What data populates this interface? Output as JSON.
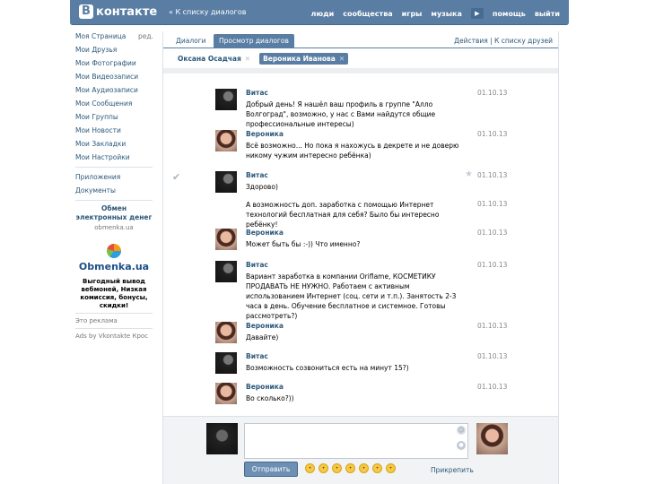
{
  "header": {
    "logo_letter": "B",
    "logo_text": "контакте",
    "back_link": "« К списку диалогов",
    "nav": [
      "люди",
      "сообщества",
      "игры",
      "музыка"
    ],
    "play_icon": "play-icon",
    "nav_right": [
      "помощь",
      "выйти"
    ]
  },
  "sidebar": {
    "items": [
      "Моя Страница",
      "Мои Друзья",
      "Мои Фотографии",
      "Мои Видеозаписи",
      "Мои Аудиозаписи",
      "Мои Сообщения",
      "Мои Группы",
      "Мои Новости",
      "Мои Закладки",
      "Мои Настройки"
    ],
    "edit_label": "ред.",
    "extra_items": [
      "Приложения",
      "Документы"
    ],
    "ad": {
      "title": "Обмен электронных денег",
      "url": "obmenka.ua",
      "logo_text": "Obmenka.ua",
      "description": "Выгодный вывод вебмоней, Низкая комиссия, бонусы, скидки!",
      "small1": "Это реклама",
      "small2": "Ads by Vkontakte Крос"
    }
  },
  "tabs": {
    "items": [
      "Диалоги",
      "Просмотр диалогов"
    ],
    "right": "Действия | К списку друзей"
  },
  "participants": [
    {
      "name": "Оксана Осадчая"
    },
    {
      "name": "Вероника Иванова"
    }
  ],
  "messages": [
    {
      "name": "Витас",
      "avatar": "vitas",
      "text": "Добрый день! Я нашёл ваш профиль в группе \"Алло Волгоград\", возможно, у нас с Вами найдутся общие профессиональные интересы)",
      "time": "01.10.13"
    },
    {
      "name": "Вероника",
      "avatar": "veronika",
      "text": "Всё возможно... Но пока я нахожусь в декрете и не доверю никому чужим интересно ребёнка)",
      "time": "01.10.13"
    },
    {
      "name": "Витас",
      "avatar": "vitas",
      "text": "Здорово)",
      "time": "01.10.13"
    },
    {
      "name": "",
      "avatar": "",
      "text": "А возможность доп. заработка с помощью Интернет технологий бесплатная для себя? Было бы интересно ребёнку!",
      "time": "01.10.13"
    },
    {
      "name": "Вероника",
      "avatar": "veronika",
      "text": "Может быть бы :-)) Что именно?",
      "time": "01.10.13"
    },
    {
      "name": "Витас",
      "avatar": "vitas",
      "text": "Вариант заработка в компании Oriflame, КОСМЕТИКУ ПРОДАВАТЬ НЕ НУЖНО. Работаем с активным использованием Интернет (соц. сети и т.п.). Занятость 2-3 часа в день. Обучение бесплатное и системное. Готовы рассмотреть?)",
      "time": "01.10.13"
    },
    {
      "name": "Вероника",
      "avatar": "veronika",
      "text": "Давайте)",
      "time": "01.10.13"
    },
    {
      "name": "Витас",
      "avatar": "vitas",
      "text": "Возможность созвониться есть на минут 15?)",
      "time": "01.10.13"
    },
    {
      "name": "Вероника",
      "avatar": "veronika",
      "text": "Во сколько?))",
      "time": "01.10.13"
    }
  ],
  "composer": {
    "send_label": "Отправить",
    "attach_label": "Прикрепить",
    "emoji_count_icons": [
      "smile-icon",
      "grin-icon",
      "wink-icon",
      "laugh-icon",
      "angry-icon",
      "sad-icon",
      "cool-icon"
    ]
  }
}
